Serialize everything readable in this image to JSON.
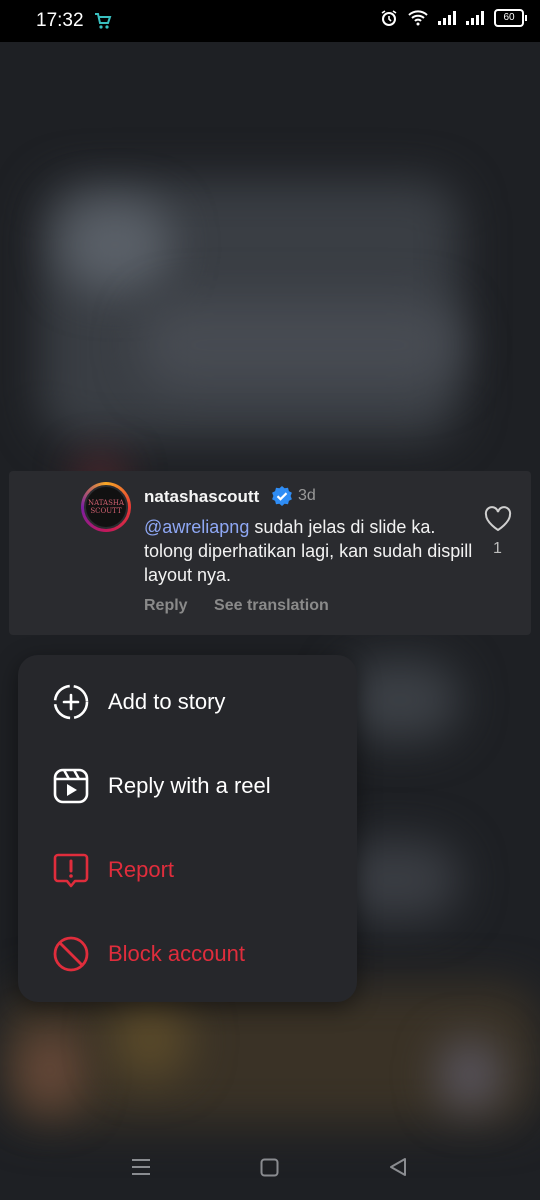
{
  "status_bar": {
    "time": "17:32",
    "battery": "60"
  },
  "comment": {
    "avatar_text": "NATASHA SCOUTT",
    "username": "natashascoutt",
    "age": "3d",
    "mention": "@awreliapng",
    "text": " sudah jelas di slide ka. tolong diperhatikan lagi, kan sudah dispill layout nya.",
    "reply_label": "Reply",
    "translate_label": "See translation",
    "like_count": "1"
  },
  "menu": {
    "items": [
      {
        "label": "Add to story",
        "icon": "add-to-story-icon"
      },
      {
        "label": "Reply with a reel",
        "icon": "reel-icon"
      },
      {
        "label": "Report",
        "icon": "report-icon"
      },
      {
        "label": "Block account",
        "icon": "block-icon"
      }
    ]
  },
  "colors": {
    "danger": "#e02d3c",
    "mention": "#8fa8f5",
    "verified": "#2f8df5"
  },
  "nav_icons": [
    "recents-icon",
    "home-icon",
    "back-icon"
  ]
}
